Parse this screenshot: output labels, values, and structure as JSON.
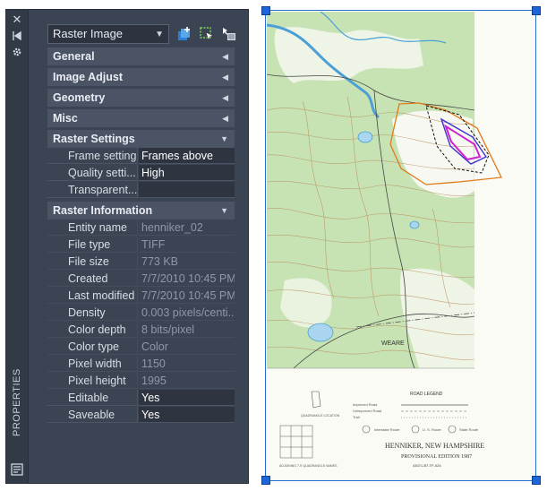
{
  "palette": {
    "title": "PROPERTIES",
    "object_type": "Raster Image",
    "sections": {
      "general": "General",
      "image_adjust": "Image Adjust",
      "geometry": "Geometry",
      "misc": "Misc",
      "raster_settings": "Raster Settings",
      "raster_information": "Raster Information"
    },
    "raster_settings_rows": [
      {
        "name": "Frame setting",
        "value": "Frames above"
      },
      {
        "name": "Quality setti...",
        "value": "High"
      },
      {
        "name": "Transparent...",
        "value": ""
      }
    ],
    "raster_information_rows": [
      {
        "name": "Entity name",
        "value": "henniker_02"
      },
      {
        "name": "File type",
        "value": "TIFF"
      },
      {
        "name": "File size",
        "value": "773 KB"
      },
      {
        "name": "Created",
        "value": "7/7/2010 10:45 PM"
      },
      {
        "name": "Last modified",
        "value": "7/7/2010 10:45 PM"
      },
      {
        "name": "Density",
        "value": "0.003 pixels/centi..."
      },
      {
        "name": "Color depth",
        "value": "8 bits/pixel"
      },
      {
        "name": "Color type",
        "value": "Color"
      },
      {
        "name": "Pixel width",
        "value": "1150"
      },
      {
        "name": "Pixel height",
        "value": "1995"
      },
      {
        "name": "Editable",
        "value": "Yes"
      },
      {
        "name": "Saveable",
        "value": "Yes"
      }
    ],
    "icons": [
      "close-icon",
      "pin-icon",
      "settings-icon",
      "properties-panel-icon",
      "quick-select-icon",
      "select-objects-icon",
      "toggle-pickadd-icon"
    ]
  },
  "map": {
    "title": "HENNIKER, NEW HAMPSHIRE",
    "edition": "PROVISIONAL EDITION 1987",
    "code": "43071-B7-TF-024",
    "road_legend": "ROAD LEGEND",
    "quadrangle_location": "QUADRANGLE LOCATION",
    "adjoining": "ADJOINING 7.5' QUADRANGLE NAMES",
    "place_label": "WEARE",
    "road_improved": "Improved Road",
    "road_unimproved": "Unimproved Road",
    "trail": "Trail",
    "route_interstate": "Interstate Route",
    "route_us": "U. S. Route",
    "route_state": "State Route",
    "colors": {
      "frame": "#2a6dd0",
      "vegetation": "#c7e3b4",
      "water": "#a9d6ee",
      "contour": "#b98a5a",
      "boundary_orange": "#e07a1a",
      "parcel_magenta": "#d020d0",
      "parcel_blue": "#4030d0"
    }
  }
}
